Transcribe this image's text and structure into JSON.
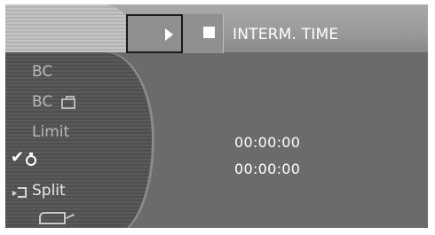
{
  "header": {
    "mode_label": "INTERM. TIME"
  },
  "menu": {
    "items": [
      {
        "label": "BC"
      },
      {
        "label": "BC"
      },
      {
        "label": "Limit"
      },
      {
        "label": ""
      },
      {
        "label": "Split"
      },
      {
        "label": ""
      }
    ]
  },
  "timer": {
    "value_1": "00:00:00",
    "value_2": "00:00:00"
  },
  "icons": {
    "play": "play-icon",
    "stop": "stop-icon",
    "check": "check-icon",
    "stopwatch": "stopwatch-icon",
    "split": "split-icon",
    "suitcase": "suitcase-icon",
    "oilcan": "oil-can-icon"
  },
  "colors": {
    "background": "#6b6b6b",
    "text": "#ffffff",
    "menu_text": "#b8b8b8"
  }
}
